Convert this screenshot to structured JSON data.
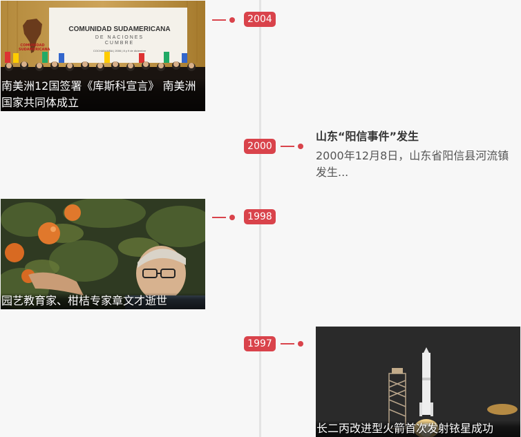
{
  "colors": {
    "accent": "#d9434b",
    "axis": "#e4e4e4",
    "background": "#f7f7f7"
  },
  "events": [
    {
      "year": "2004",
      "caption": "南美洲12国签署《库斯科宣言》 南美洲国家共同体成立",
      "banner_title": "COMUNIDAD SUDAMERICANA",
      "banner_subtitle": "DE NACIONES",
      "banner_line": "CUMBRE",
      "banner_place": "COCHABAMBA | 2006 | 8 y 9 de diciembre",
      "logo_text": "COMUNIDAD SUDAMERICANA",
      "photo_icon": "summit-photo"
    },
    {
      "year": "2000",
      "title": "山东“阳信事件”发生",
      "summary": "2000年12月8日，山东省阳信县河流镇发生..."
    },
    {
      "year": "1998",
      "caption": "园艺教育家、柑桔专家章文才逝世",
      "photo_icon": "orange-tree-photo"
    },
    {
      "year": "1997",
      "caption": "长二丙改进型火箭首次发射铱星成功",
      "photo_icon": "rocket-launch-photo"
    }
  ]
}
